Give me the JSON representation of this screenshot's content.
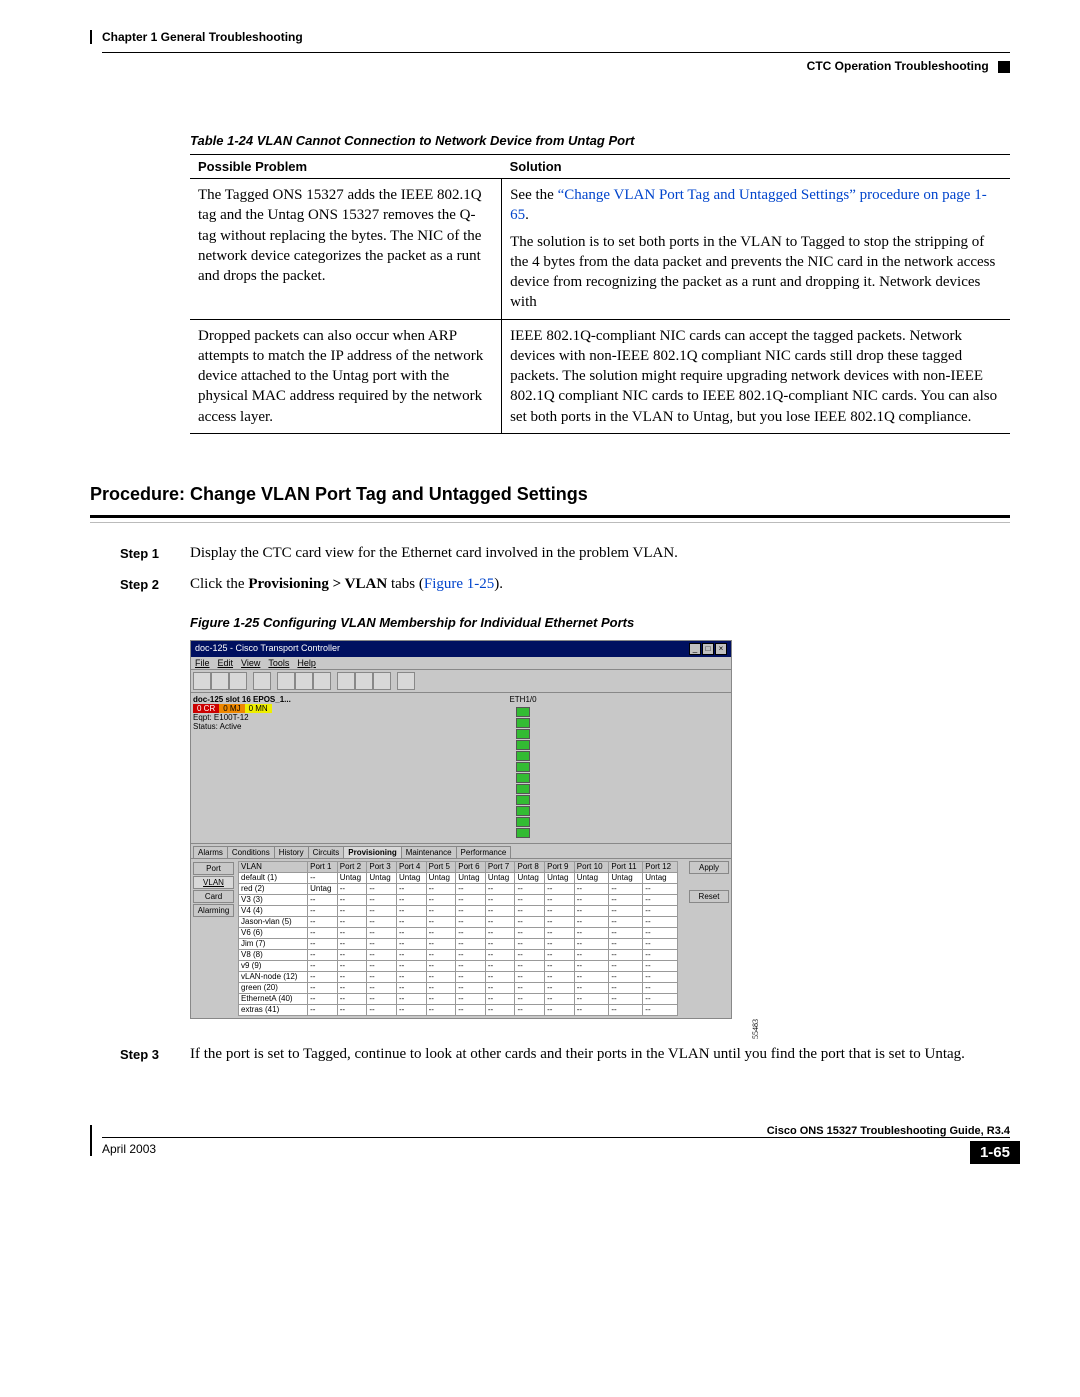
{
  "header": {
    "chapter": "Chapter 1      General Troubleshooting",
    "section": "CTC Operation Troubleshooting"
  },
  "table124": {
    "caption": "Table 1-24    VLAN Cannot Connection to Network Device from Untag Port",
    "h1": "Possible Problem",
    "h2": "Solution",
    "r1c1": "The Tagged ONS 15327 adds the IEEE 802.1Q tag and the Untag ONS 15327 removes the Q-tag without replacing the bytes. The NIC of the network device categorizes the packet as a runt and drops the packet.",
    "r1c2a": "See the ",
    "r1c2link": "“Change VLAN Port Tag and Untagged Settings” procedure on page 1-65",
    "r1c2b": ".",
    "r1c2p2": "The solution is to set both ports in the VLAN to Tagged to stop the stripping of the 4 bytes from the data packet and prevents the NIC card in the network access device from recognizing the packet as a runt and dropping it. Network devices with",
    "r2c1": "Dropped packets can also occur when ARP attempts to match the IP address of the network device attached to the Untag port with the physical MAC address required by the network access layer.",
    "r2c2": "IEEE 802.1Q-compliant NIC cards can accept the tagged packets. Network devices with non-IEEE 802.1Q compliant NIC cards still drop these tagged packets. The solution might require upgrading network devices with non-IEEE 802.1Q compliant NIC cards to IEEE 802.1Q-compliant NIC cards. You can also set both ports in the VLAN to Untag, but you lose IEEE 802.1Q compliance."
  },
  "procedure": {
    "heading": "Procedure: Change VLAN Port Tag and Untagged Settings",
    "step1label": "Step 1",
    "step1": "Display the CTC card view for the Ethernet card involved in the problem VLAN.",
    "step2label": "Step 2",
    "step2a": "Click the ",
    "step2b": "Provisioning > VLAN",
    "step2c": " tabs (",
    "step2d": "Figure 1-25",
    "step2e": ").",
    "step3label": "Step 3",
    "step3": "If the port is set to Tagged, continue to look at other cards and their ports in the VLAN until you find the port that is set to Untag."
  },
  "figure125": {
    "caption": "Figure 1-25    Configuring VLAN Membership for Individual Ethernet Ports",
    "title": "doc-125 - Cisco Transport Controller",
    "menu": {
      "file": "File",
      "edit": "Edit",
      "view": "View",
      "tools": "Tools",
      "help": "Help"
    },
    "nodeline": "doc-125 slot 16 EPOS_1...",
    "cr": "0 CR",
    "mj": "0 MJ",
    "mn": "0 MN",
    "eqpt": "Eqpt: E100T-12",
    "status": "Status: Active",
    "ethlabel": "ETH1/0",
    "tabs": [
      "Alarms",
      "Conditions",
      "History",
      "Circuits",
      "Provisioning",
      "Maintenance",
      "Performance"
    ],
    "sidetabs": [
      "Port",
      "VLAN",
      "Card",
      "Alarming"
    ],
    "ports": [
      "VLAN",
      "Port 1",
      "Port 2",
      "Port 3",
      "Port 4",
      "Port 5",
      "Port 6",
      "Port 7",
      "Port 8",
      "Port 9",
      "Port 10",
      "Port 11",
      "Port 12"
    ],
    "rows": [
      {
        "name": "default (1)",
        "vals": [
          "--",
          "Untag",
          "Untag",
          "Untag",
          "Untag",
          "Untag",
          "Untag",
          "Untag",
          "Untag",
          "Untag",
          "Untag",
          "Untag"
        ]
      },
      {
        "name": "red (2)",
        "vals": [
          "Untag",
          "--",
          "--",
          "--",
          "--",
          "--",
          "--",
          "--",
          "--",
          "--",
          "--",
          "--"
        ]
      },
      {
        "name": "V3 (3)",
        "vals": [
          "--",
          "--",
          "--",
          "--",
          "--",
          "--",
          "--",
          "--",
          "--",
          "--",
          "--",
          "--"
        ]
      },
      {
        "name": "V4 (4)",
        "vals": [
          "--",
          "--",
          "--",
          "--",
          "--",
          "--",
          "--",
          "--",
          "--",
          "--",
          "--",
          "--"
        ]
      },
      {
        "name": "Jason-vlan (5)",
        "vals": [
          "--",
          "--",
          "--",
          "--",
          "--",
          "--",
          "--",
          "--",
          "--",
          "--",
          "--",
          "--"
        ]
      },
      {
        "name": "V6 (6)",
        "vals": [
          "--",
          "--",
          "--",
          "--",
          "--",
          "--",
          "--",
          "--",
          "--",
          "--",
          "--",
          "--"
        ]
      },
      {
        "name": "Jim (7)",
        "vals": [
          "--",
          "--",
          "--",
          "--",
          "--",
          "--",
          "--",
          "--",
          "--",
          "--",
          "--",
          "--"
        ]
      },
      {
        "name": "V8 (8)",
        "vals": [
          "--",
          "--",
          "--",
          "--",
          "--",
          "--",
          "--",
          "--",
          "--",
          "--",
          "--",
          "--"
        ]
      },
      {
        "name": "v9 (9)",
        "vals": [
          "--",
          "--",
          "--",
          "--",
          "--",
          "--",
          "--",
          "--",
          "--",
          "--",
          "--",
          "--"
        ]
      },
      {
        "name": "vLAN-node (12)",
        "vals": [
          "--",
          "--",
          "--",
          "--",
          "--",
          "--",
          "--",
          "--",
          "--",
          "--",
          "--",
          "--"
        ]
      },
      {
        "name": "green (20)",
        "vals": [
          "--",
          "--",
          "--",
          "--",
          "--",
          "--",
          "--",
          "--",
          "--",
          "--",
          "--",
          "--"
        ]
      },
      {
        "name": "EthernetA (40)",
        "vals": [
          "--",
          "--",
          "--",
          "--",
          "--",
          "--",
          "--",
          "--",
          "--",
          "--",
          "--",
          "--"
        ]
      },
      {
        "name": "extras (41)",
        "vals": [
          "--",
          "--",
          "--",
          "--",
          "--",
          "--",
          "--",
          "--",
          "--",
          "--",
          "--",
          "--"
        ]
      }
    ],
    "apply": "Apply",
    "reset": "Reset",
    "figid": "55483"
  },
  "footer": {
    "guide": "Cisco ONS 15327 Troubleshooting Guide, R3.4",
    "date": "April 2003",
    "page": "1-65"
  }
}
